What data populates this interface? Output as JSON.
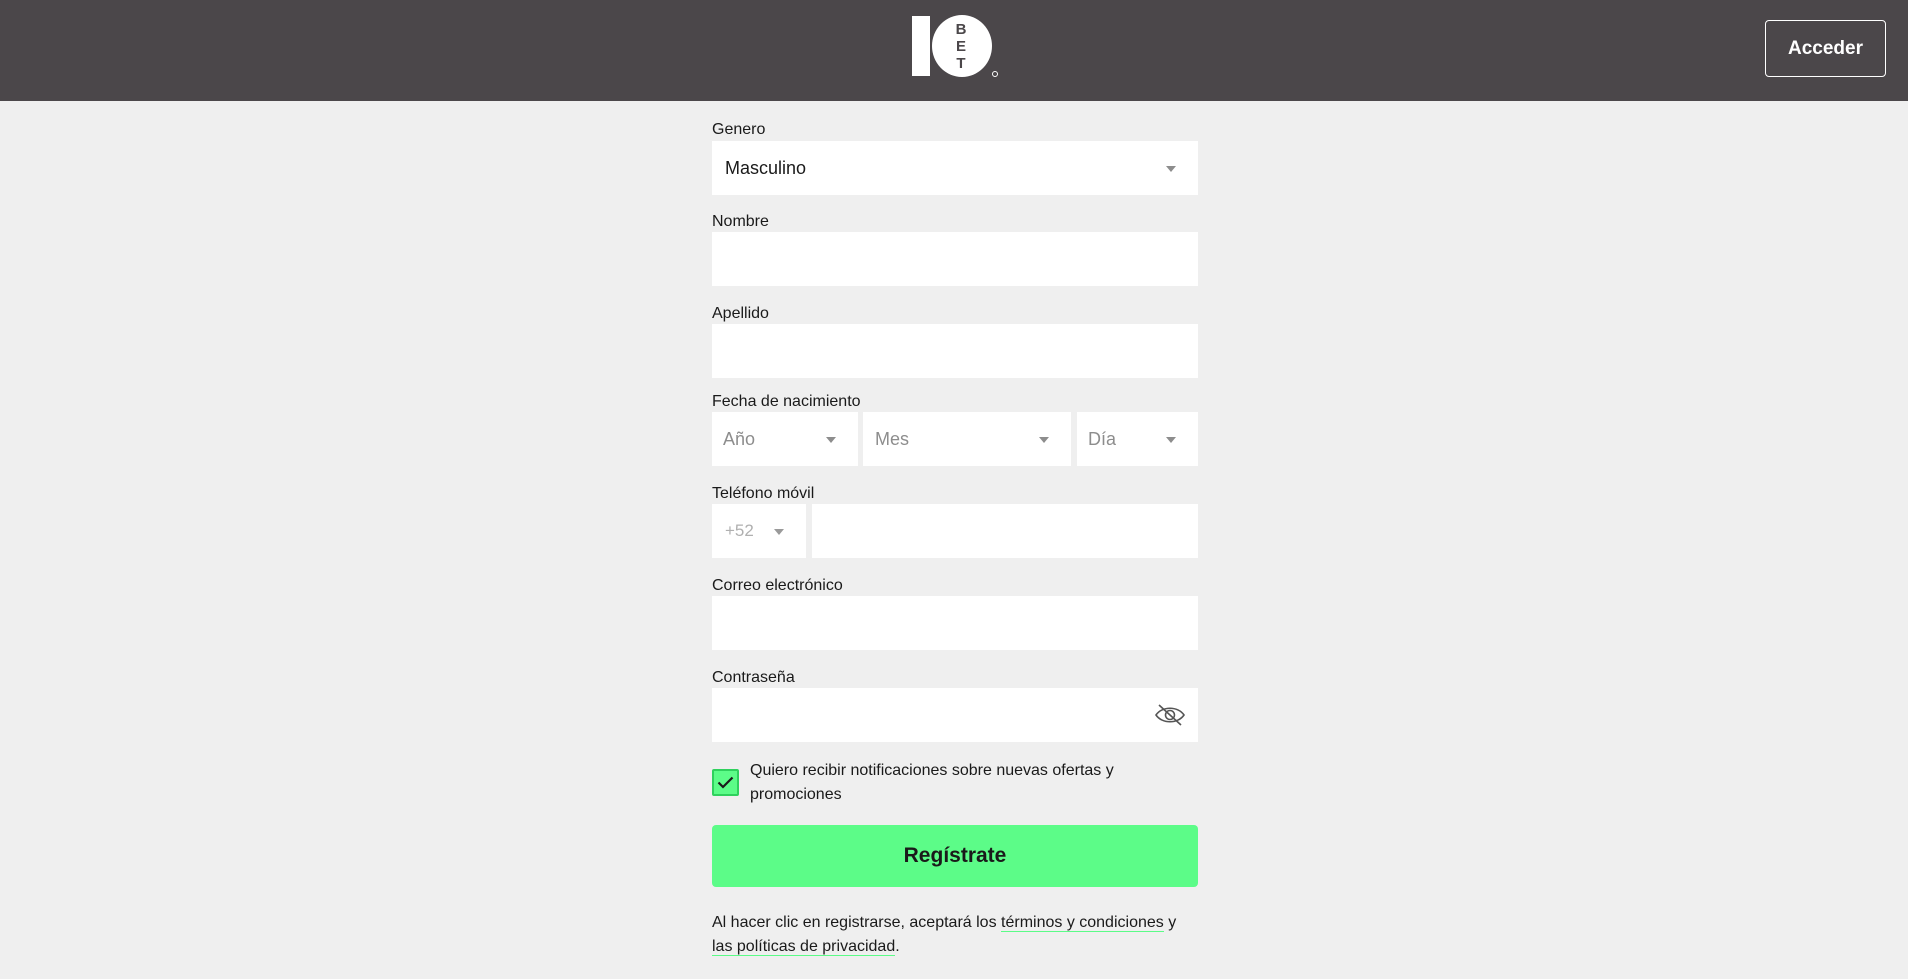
{
  "header": {
    "logo_alt": "10BET",
    "logo_number": "10",
    "logo_letters": [
      "B",
      "E",
      "T"
    ],
    "login_label": "Acceder"
  },
  "form": {
    "gender": {
      "label": "Genero",
      "value": "Masculino"
    },
    "first_name": {
      "label": "Nombre",
      "value": ""
    },
    "last_name": {
      "label": "Apellido",
      "value": ""
    },
    "birthdate": {
      "label": "Fecha de nacimiento",
      "year_placeholder": "Año",
      "month_placeholder": "Mes",
      "day_placeholder": "Día"
    },
    "phone": {
      "label": "Teléfono móvil",
      "country_code": "+52",
      "value": ""
    },
    "email": {
      "label": "Correo electrónico",
      "value": ""
    },
    "password": {
      "label": "Contraseña",
      "value": ""
    },
    "notifications": {
      "checked": true,
      "label": "Quiero recibir notificaciones sobre nuevas ofertas y promociones"
    },
    "register_label": "Regístrate",
    "terms": {
      "prefix": "Al hacer clic en registrarse, aceptará los ",
      "terms_link": "términos y condiciones",
      "middle": " y ",
      "privacy_link": "las políticas de privacidad",
      "suffix": "."
    }
  },
  "colors": {
    "header_bg": "#4b474a",
    "page_bg": "#efefef",
    "accent": "#5cfc88"
  }
}
